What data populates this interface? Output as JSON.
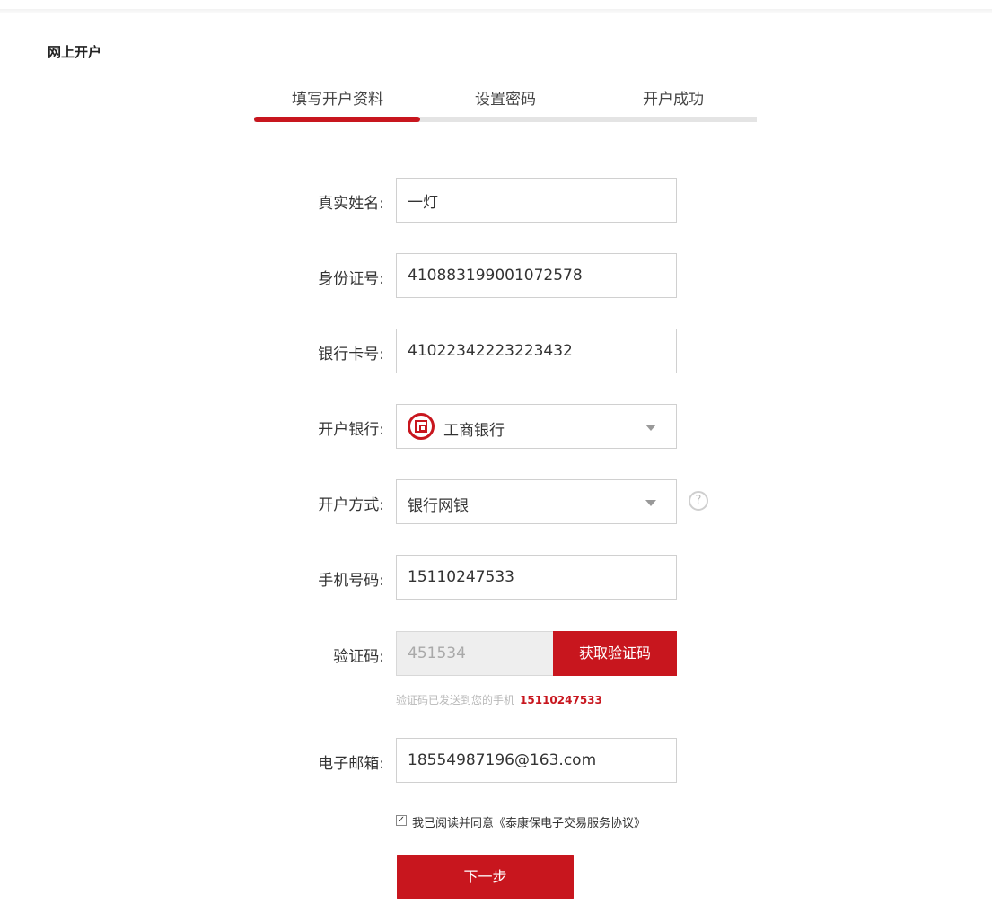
{
  "page": {
    "title": "网上开户"
  },
  "steps": {
    "items": [
      "填写开户资料",
      "设置密码",
      "开户成功"
    ],
    "current": 1,
    "progress": 0.33
  },
  "form": {
    "name": {
      "label": "真实姓名:",
      "value": "一灯"
    },
    "id_number": {
      "label": "身份证号:",
      "value": "410883199001072578"
    },
    "card_number": {
      "label": "银行卡号:",
      "value": "41022342223223432"
    },
    "bank": {
      "label": "开户银行:",
      "selected": "工商银行",
      "icon": "icbc-logo-icon"
    },
    "method": {
      "label": "开户方式:",
      "selected": "银行网银",
      "help_icon": "question-circle-icon"
    },
    "phone": {
      "label": "手机号码:",
      "value": "15110247533"
    },
    "code": {
      "label": "验证码:",
      "value": "451534",
      "button_label": "获取验证码",
      "hint_prefix": "验证码已发送到您的手机",
      "hint_phone": "15110247533"
    },
    "email": {
      "label": "电子邮箱:",
      "value": "18554987196@163.com"
    },
    "agreement": {
      "checked": true,
      "text": "我已阅读并同意《泰康保电子交易服务协议》"
    },
    "next_label": "下一步"
  },
  "colors": {
    "accent": "#c8161e",
    "track": "#e4e4e4",
    "border": "#d0d0d0"
  }
}
